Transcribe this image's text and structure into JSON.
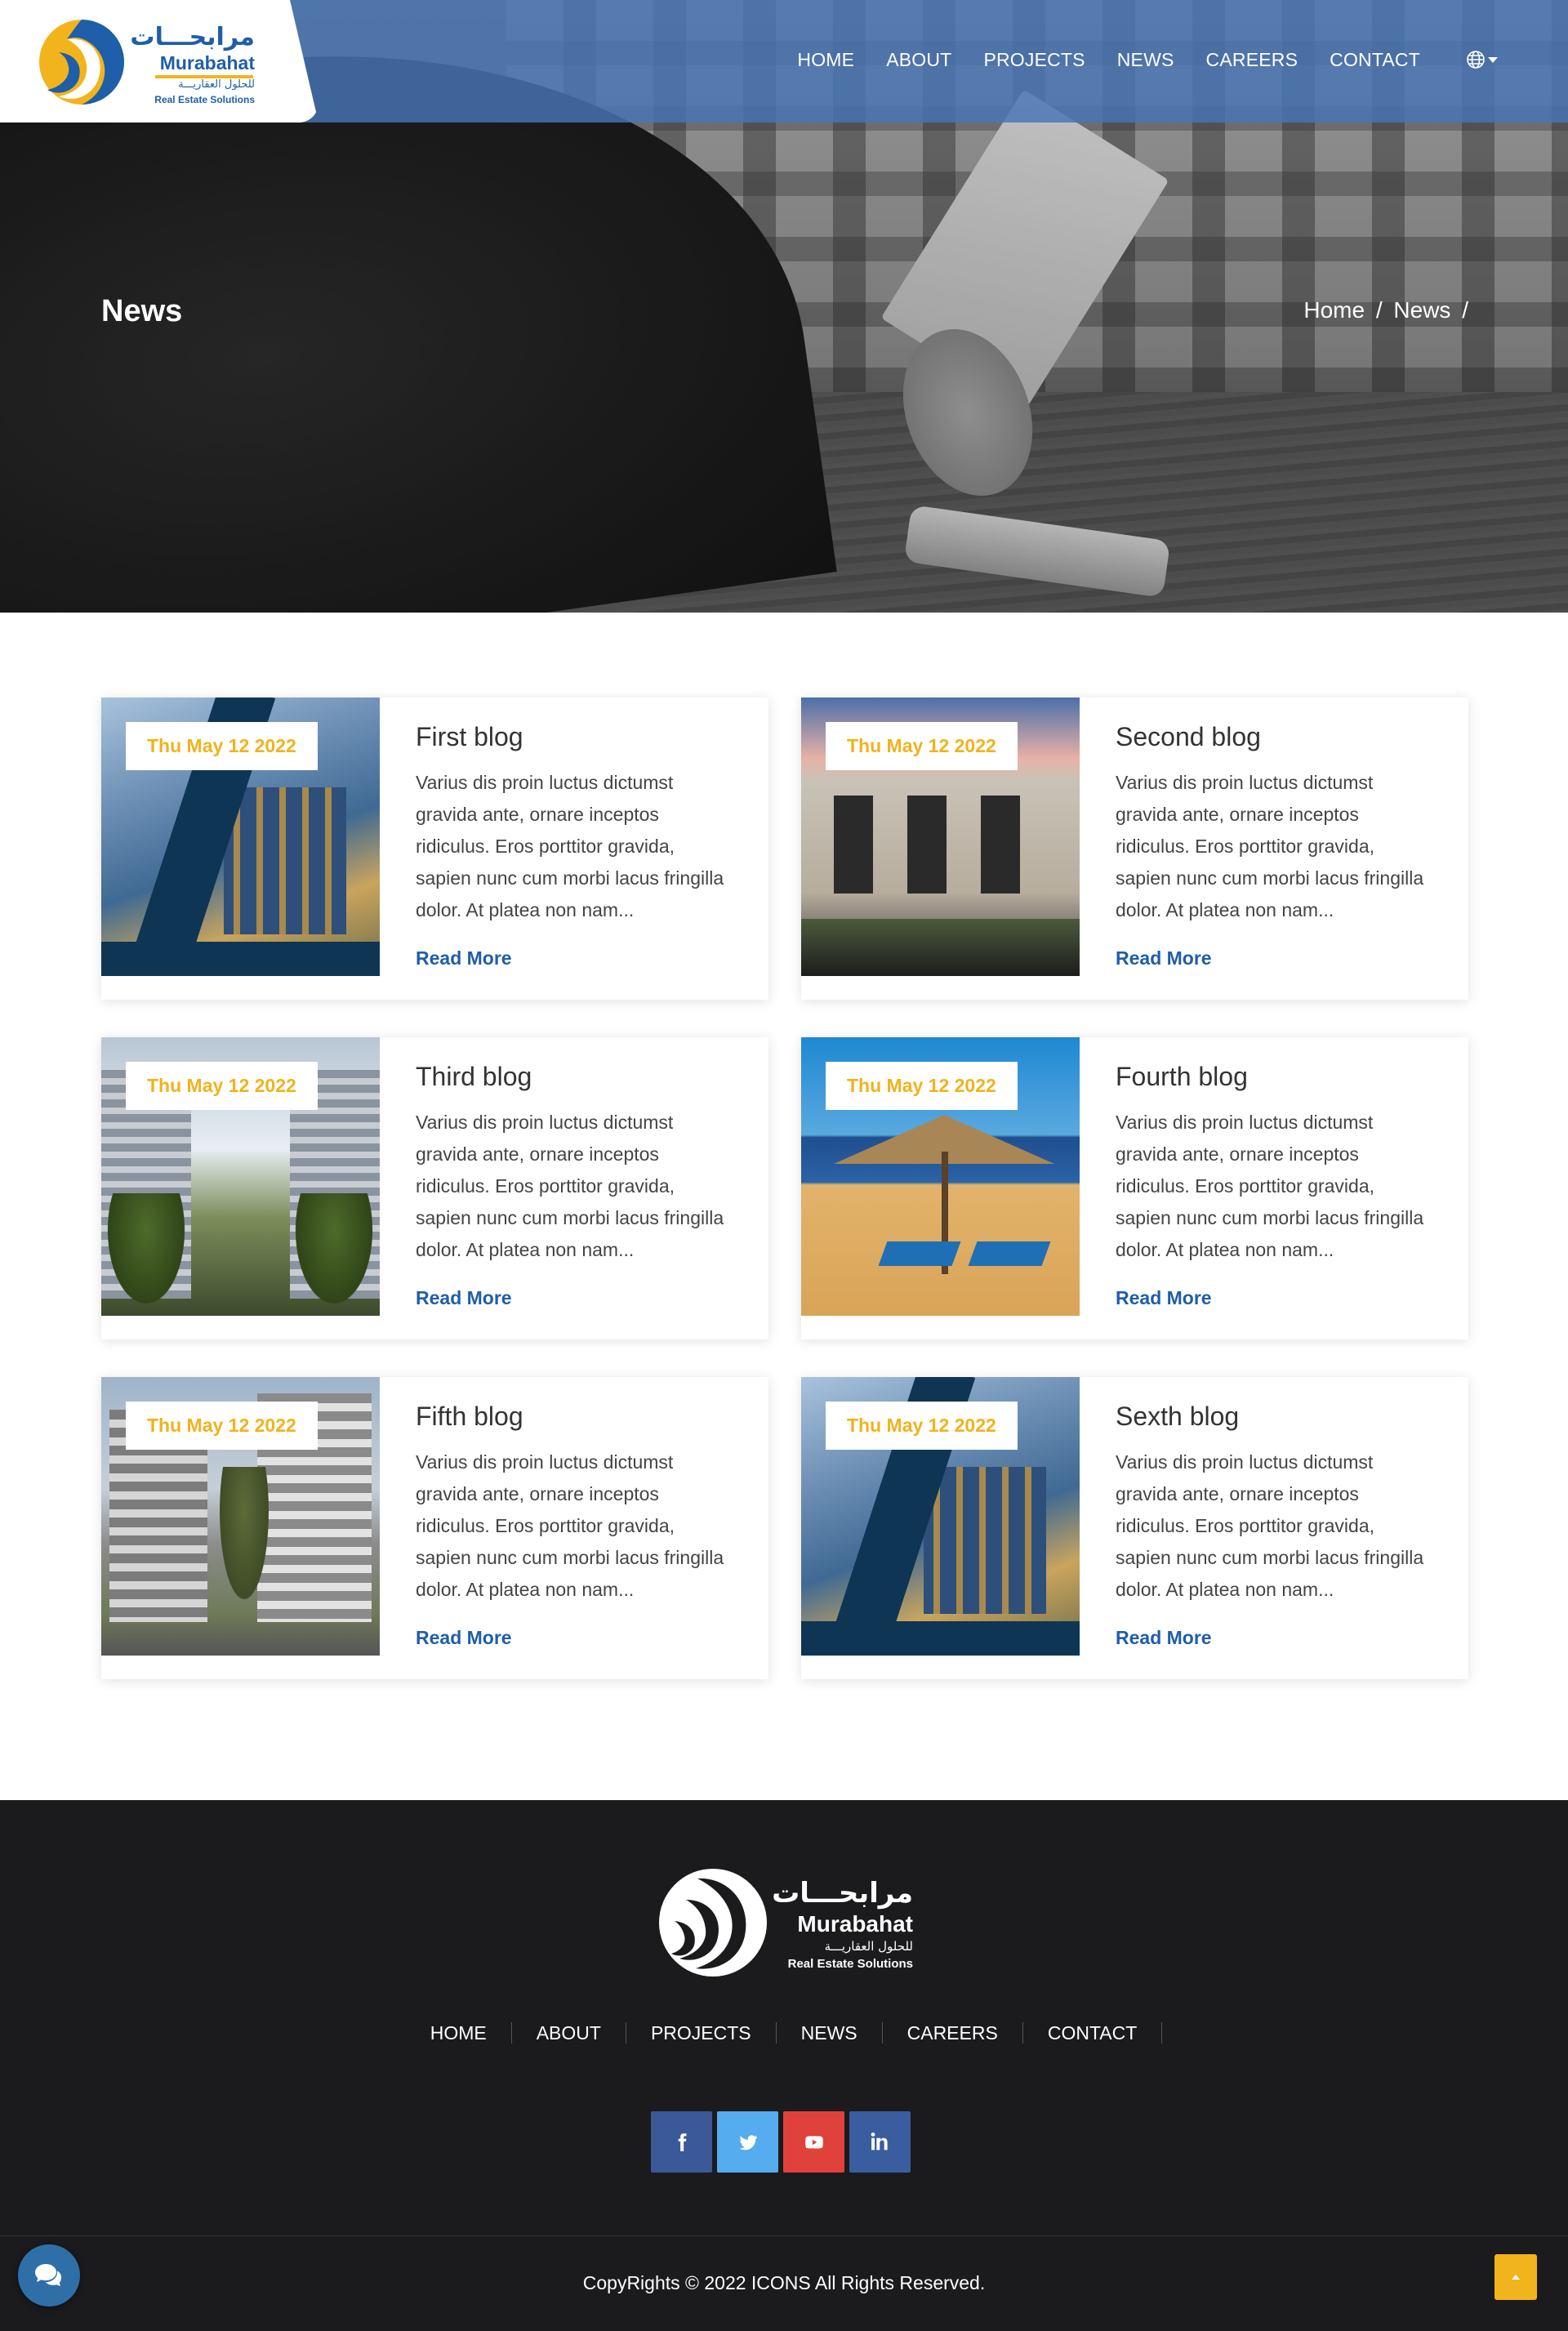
{
  "header": {
    "logo": {
      "arabic": "مرابحـــات",
      "english": "Murabahat",
      "arabic_sub": "للحلول العقاريـــة",
      "tagline": "Real Estate Solutions"
    },
    "nav": [
      "HOME",
      "ABOUT",
      "PROJECTS",
      "NEWS",
      "CAREERS",
      "CONTACT"
    ],
    "language_icon": "globe-icon"
  },
  "hero": {
    "title": "News",
    "breadcrumb": [
      "Home",
      "/",
      "News",
      "/"
    ]
  },
  "posts": [
    {
      "date": "Thu May 12 2022",
      "title": "First blog",
      "excerpt": "Varius dis proin luctus dictumst gravida ante, ornare inceptos ridiculus. Eros porttitor gravida, sapien nunc cum morbi lacus fringilla dolor. At platea non nam...",
      "link": "Read More"
    },
    {
      "date": "Thu May 12 2022",
      "title": "Second blog",
      "excerpt": "Varius dis proin luctus dictumst gravida ante, ornare inceptos ridiculus. Eros porttitor gravida, sapien nunc cum morbi lacus fringilla dolor. At platea non nam...",
      "link": "Read More"
    },
    {
      "date": "Thu May 12 2022",
      "title": "Third blog",
      "excerpt": "Varius dis proin luctus dictumst gravida ante, ornare inceptos ridiculus. Eros porttitor gravida, sapien nunc cum morbi lacus fringilla dolor. At platea non nam...",
      "link": "Read More"
    },
    {
      "date": "Thu May 12 2022",
      "title": "Fourth blog",
      "excerpt": "Varius dis proin luctus dictumst gravida ante, ornare inceptos ridiculus. Eros porttitor gravida, sapien nunc cum morbi lacus fringilla dolor. At platea non nam...",
      "link": "Read More"
    },
    {
      "date": "Thu May 12 2022",
      "title": "Fifth blog",
      "excerpt": "Varius dis proin luctus dictumst gravida ante, ornare inceptos ridiculus. Eros porttitor gravida, sapien nunc cum morbi lacus fringilla dolor. At platea non nam...",
      "link": "Read More"
    },
    {
      "date": "Thu May 12 2022",
      "title": "Sexth blog",
      "excerpt": "Varius dis proin luctus dictumst gravida ante, ornare inceptos ridiculus. Eros porttitor gravida, sapien nunc cum morbi lacus fringilla dolor. At platea non nam...",
      "link": "Read More"
    }
  ],
  "footer": {
    "logo": {
      "arabic": "مرابحـــات",
      "english": "Murabahat",
      "arabic_sub": "للحلول العقاريـــة",
      "tagline": "Real Estate Solutions"
    },
    "nav": [
      "HOME",
      "ABOUT",
      "PROJECTS",
      "NEWS",
      "CAREERS",
      "CONTACT"
    ],
    "social": [
      {
        "name": "facebook-icon",
        "color": "#3b5998"
      },
      {
        "name": "twitter-icon",
        "color": "#55acee"
      },
      {
        "name": "youtube-icon",
        "color": "#e0413a"
      },
      {
        "name": "linkedin-icon",
        "color": "#3a5d9f"
      }
    ],
    "copyright": "CopyRights © 2022 ICONS All Rights Reserved."
  },
  "colors": {
    "brand_blue": "#1f5ea8",
    "accent_yellow": "#f2b41c",
    "date_text": "#f0b31d",
    "footer_bg": "#1b1b1d"
  },
  "floating": {
    "chat_icon": "chat-icon",
    "scroll_top_icon": "arrow-up-icon"
  }
}
